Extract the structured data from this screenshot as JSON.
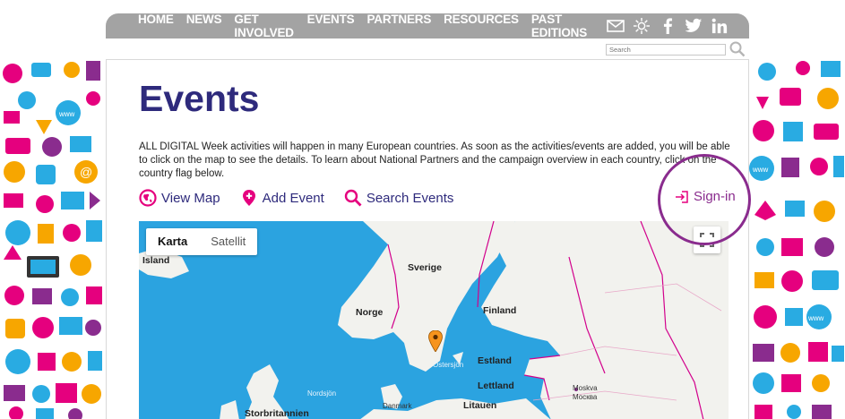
{
  "nav": {
    "items": [
      "HOME",
      "NEWS",
      "GET INVOLVED",
      "EVENTS",
      "PARTNERS",
      "RESOURCES",
      "PAST EDITIONS"
    ],
    "social": [
      "mail-icon",
      "sun-icon",
      "facebook-icon",
      "twitter-icon",
      "linkedin-icon"
    ]
  },
  "search": {
    "placeholder": "Search"
  },
  "page": {
    "title": "Events",
    "intro": "ALL DIGITAL Week activities will happen in many European countries. As soon as the activities/events are added, you will be able to click on the map to see the details. To learn about National Partners and the campaign overview in each country, click on the country flag below."
  },
  "actions": {
    "view_map": "View Map",
    "add_event": "Add Event",
    "search_events": "Search Events",
    "sign_in": "Sign-in"
  },
  "map": {
    "type_map": "Karta",
    "type_satellite": "Satellit",
    "labels": {
      "island": "Island",
      "sverige": "Sverige",
      "norge": "Norge",
      "finland": "Finland",
      "ostersjon": "Östersjön",
      "estland": "Estland",
      "lettland": "Lettland",
      "moskva": "Moskva",
      "moskva_sub": "Москва",
      "nordsjon": "Nordsjön",
      "danmark": "Danmark",
      "litauen": "Litauen",
      "storbritannien": "Storbritannien"
    }
  },
  "colors": {
    "title": "#2e2a7c",
    "accent": "#e5007e",
    "signin": "#8a2c8e",
    "nav_bg": "#a3a3a3",
    "sea": "#2ba3e0"
  }
}
